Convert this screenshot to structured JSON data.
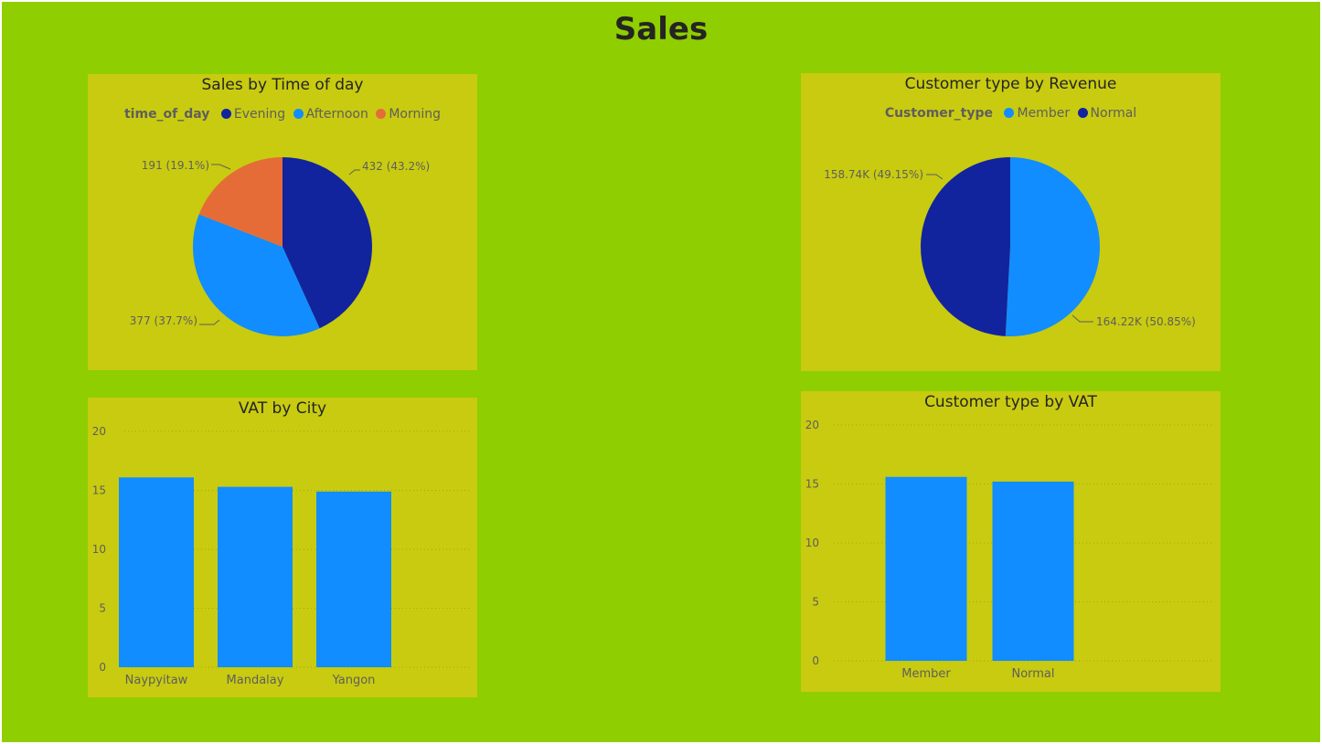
{
  "page": {
    "title": "Sales"
  },
  "colors": {
    "canvas": "#8fce00",
    "card": "#c8cb10",
    "dark_blue": "#12239e",
    "light_blue": "#118dff",
    "orange": "#e66c37",
    "text_dark": "#252423",
    "text_muted": "#605e5c"
  },
  "chart_data": [
    {
      "id": "sales_by_time",
      "type": "pie",
      "title": "Sales by Time of day",
      "legend_title": "time_of_day",
      "legend_position": "top",
      "slices": [
        {
          "name": "Evening",
          "value": 432,
          "label": "432 (43.2%)",
          "color": "#12239e"
        },
        {
          "name": "Afternoon",
          "value": 377,
          "label": "377 (37.7%)",
          "color": "#118dff"
        },
        {
          "name": "Morning",
          "value": 191,
          "label": "191 (19.1%)",
          "color": "#e66c37"
        }
      ]
    },
    {
      "id": "customer_by_revenue",
      "type": "pie",
      "title": "Customer type by Revenue",
      "legend_title": "Customer_type",
      "legend_position": "top",
      "slices": [
        {
          "name": "Member",
          "value": 164220,
          "label": "164.22K (50.85%)",
          "color": "#118dff"
        },
        {
          "name": "Normal",
          "value": 158740,
          "label": "158.74K (49.15%)",
          "color": "#12239e"
        }
      ]
    },
    {
      "id": "vat_by_city",
      "type": "bar",
      "title": "VAT by City",
      "categories": [
        "Naypyitaw",
        "Mandalay",
        "Yangon"
      ],
      "values": [
        16.1,
        15.3,
        14.9
      ],
      "ylim": [
        0,
        20
      ],
      "yticks": [
        "0",
        "5",
        "10",
        "15",
        "20"
      ],
      "grid": true,
      "color": "#118dff"
    },
    {
      "id": "customer_by_vat",
      "type": "bar",
      "title": "Customer type by VAT",
      "categories": [
        "Member",
        "Normal"
      ],
      "values": [
        15.6,
        15.2
      ],
      "ylim": [
        0,
        20
      ],
      "yticks": [
        "0",
        "5",
        "10",
        "15",
        "20"
      ],
      "grid": true,
      "color": "#118dff"
    }
  ]
}
